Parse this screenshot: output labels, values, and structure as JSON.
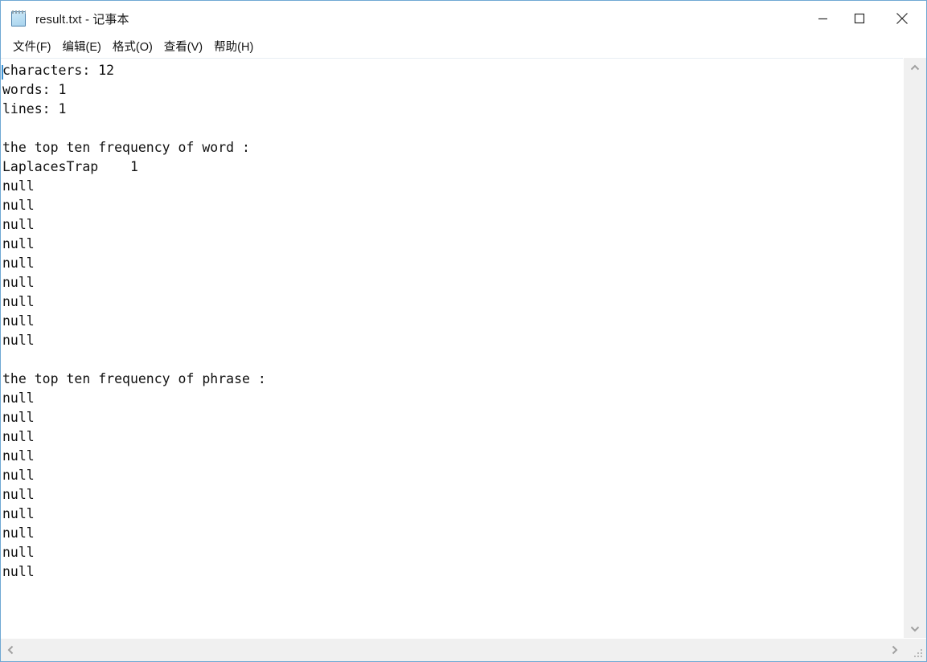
{
  "window": {
    "title": "result.txt - 记事本",
    "icon": "notepad-icon",
    "border_color": "#6fa8d4",
    "controls": {
      "minimize": "minimize-icon",
      "maximize": "maximize-icon",
      "close": "close-icon"
    }
  },
  "menubar": {
    "items": [
      {
        "label": "文件(F)"
      },
      {
        "label": "编辑(E)"
      },
      {
        "label": "格式(O)"
      },
      {
        "label": "查看(V)"
      },
      {
        "label": "帮助(H)"
      }
    ]
  },
  "document": {
    "lines": [
      "characters: 12",
      "words: 1",
      "lines: 1",
      "",
      "the top ten frequency of word :",
      "LaplacesTrap    1",
      "null",
      "null",
      "null",
      "null",
      "null",
      "null",
      "null",
      "null",
      "null",
      "",
      "the top ten frequency of phrase :",
      "null",
      "null",
      "null",
      "null",
      "null",
      "null",
      "null",
      "null",
      "null",
      "null"
    ],
    "stats": {
      "characters": 12,
      "words": 1,
      "lines": 1
    },
    "word_frequency_header": "the top ten frequency of word :",
    "word_frequency": [
      {
        "term": "LaplacesTrap",
        "count": 1
      },
      {
        "term": "null",
        "count": null
      },
      {
        "term": "null",
        "count": null
      },
      {
        "term": "null",
        "count": null
      },
      {
        "term": "null",
        "count": null
      },
      {
        "term": "null",
        "count": null
      },
      {
        "term": "null",
        "count": null
      },
      {
        "term": "null",
        "count": null
      },
      {
        "term": "null",
        "count": null
      },
      {
        "term": "null",
        "count": null
      }
    ],
    "phrase_frequency_header": "the top ten frequency of phrase :",
    "phrase_frequency": [
      {
        "term": "null",
        "count": null
      },
      {
        "term": "null",
        "count": null
      },
      {
        "term": "null",
        "count": null
      },
      {
        "term": "null",
        "count": null
      },
      {
        "term": "null",
        "count": null
      },
      {
        "term": "null",
        "count": null
      },
      {
        "term": "null",
        "count": null
      },
      {
        "term": "null",
        "count": null
      },
      {
        "term": "null",
        "count": null
      },
      {
        "term": "null",
        "count": null
      }
    ]
  },
  "scrollbars": {
    "vertical": {
      "up": "chevron-up-icon",
      "down": "chevron-down-icon"
    },
    "horizontal": {
      "left": "chevron-left-icon",
      "right": "chevron-right-icon"
    },
    "grip": "resize-grip-icon"
  }
}
